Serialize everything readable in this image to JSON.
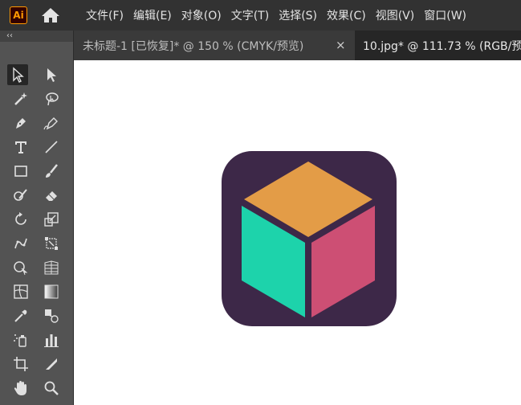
{
  "app": {
    "logo_text": "Ai",
    "icons": [
      "adobe-illustrator-logo",
      "home-icon"
    ]
  },
  "menu": [
    "文件(F)",
    "编辑(E)",
    "对象(O)",
    "文字(T)",
    "选择(S)",
    "效果(C)",
    "视图(V)",
    "窗口(W)"
  ],
  "tabs": [
    {
      "title": "未标题-1 [已恢复]* @ 150 % (CMYK/预览)",
      "close": "×",
      "active": false
    },
    {
      "title": "10.jpg* @ 111.73 % (RGB/预",
      "active": true
    }
  ],
  "toolbar": {
    "collapse_label": "‹‹",
    "tools": [
      "selection-tool",
      "direct-selection-tool",
      "magic-wand-tool",
      "lasso-tool",
      "pen-tool",
      "curvature-tool",
      "type-tool",
      "line-segment-tool",
      "rectangle-tool",
      "paintbrush-tool",
      "shaper-tool",
      "eraser-tool",
      "rotate-tool",
      "scale-tool",
      "puppet-warp-tool",
      "free-transform-tool",
      "shape-builder-tool",
      "perspective-grid-tool",
      "mesh-tool",
      "gradient-tool",
      "eyedropper-tool",
      "blend-tool",
      "symbol-sprayer-tool",
      "column-graph-tool",
      "artboard-tool",
      "slice-tool",
      "hand-tool",
      "zoom-tool"
    ]
  },
  "artwork": {
    "icons": [
      "cube-icon"
    ],
    "colors": {
      "background": "#3d2848",
      "top": "#e39c47",
      "left": "#1dd3ab",
      "right": "#cd4f74"
    }
  }
}
